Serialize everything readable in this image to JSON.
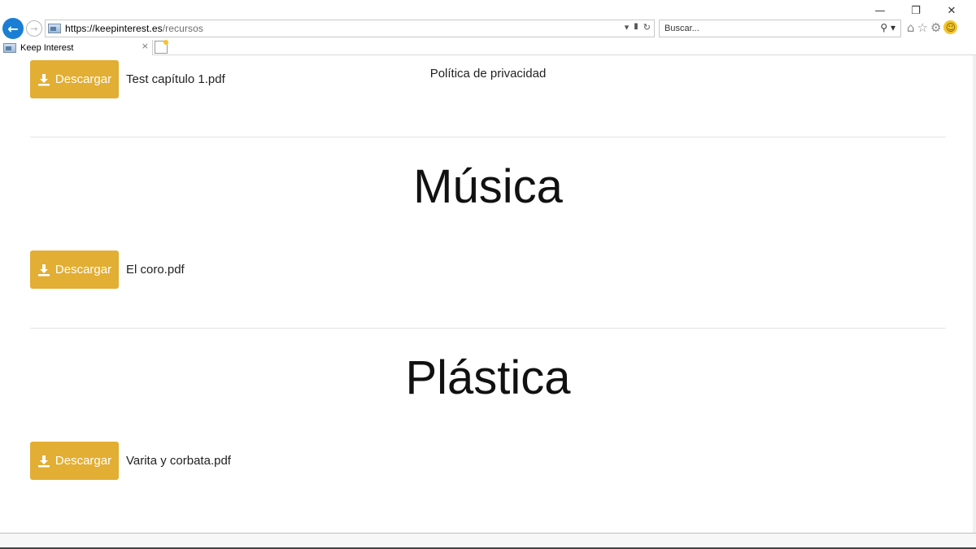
{
  "browser": {
    "url_domain": "https://keepinterest.es",
    "url_path": "/recursos",
    "search_placeholder": "Buscar...",
    "tab_title": "Keep Interest",
    "tab_close": "×",
    "window_controls": {
      "minimize": "—",
      "restore": "❐",
      "close": "✕"
    },
    "icons": {
      "back": "←",
      "forward": "→",
      "dropdown": "▾",
      "lock": "🔒",
      "refresh": "↻",
      "search": "⚲",
      "home": "⌂",
      "favorites": "☆",
      "settings": "⚙",
      "feedback": "☺"
    }
  },
  "page": {
    "privacy_link": "Política de privacidad",
    "download_label": "Descargar",
    "sections": [
      {
        "title": "",
        "files": [
          "Test capítulo 1.pdf"
        ]
      },
      {
        "title": "Música",
        "files": [
          "El coro.pdf"
        ]
      },
      {
        "title": "Plástica",
        "files": [
          "Varita y corbata.pdf"
        ]
      }
    ]
  },
  "colors": {
    "download_button": "#e2ae33",
    "back_button": "#1a7fd4"
  }
}
